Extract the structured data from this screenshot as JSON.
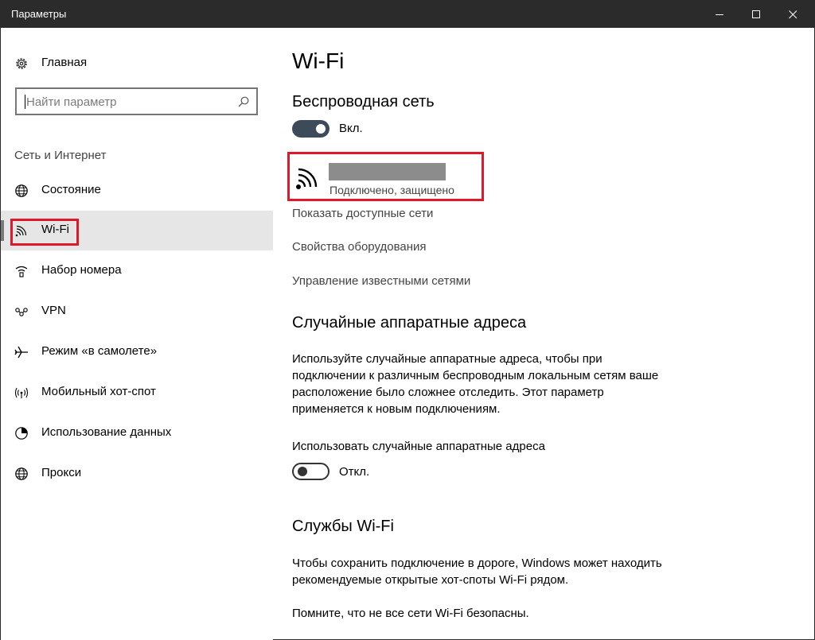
{
  "window": {
    "title": "Параметры"
  },
  "sidebar": {
    "home_label": "Главная",
    "search_placeholder": "Найти параметр",
    "section_label": "Сеть и Интернет",
    "items": [
      {
        "label": "Состояние",
        "icon": "globe-icon"
      },
      {
        "label": "Wi-Fi",
        "icon": "wifi-icon",
        "selected": true
      },
      {
        "label": "Набор номера",
        "icon": "dialup-icon"
      },
      {
        "label": "VPN",
        "icon": "vpn-icon"
      },
      {
        "label": "Режим «в самолете»",
        "icon": "airplane-icon"
      },
      {
        "label": "Мобильный хот-спот",
        "icon": "hotspot-icon"
      },
      {
        "label": "Использование данных",
        "icon": "data-usage-icon"
      },
      {
        "label": "Прокси",
        "icon": "globe-icon"
      }
    ]
  },
  "main": {
    "title": "Wi-Fi",
    "wireless": {
      "heading": "Беспроводная сеть",
      "toggle_state": "Вкл.",
      "network_status": "Подключено, защищено"
    },
    "links": {
      "show_networks": "Показать доступные сети",
      "hardware_props": "Свойства оборудования",
      "manage_known": "Управление известными сетями"
    },
    "random_hw": {
      "heading": "Случайные аппаратные адреса",
      "description": "Используйте случайные аппаратные адреса, чтобы при подключении к различным беспроводным локальным сетям ваше расположение было сложнее отследить. Этот параметр применяется к новым подключениям.",
      "toggle_label": "Использовать случайные аппаратные адреса",
      "toggle_state": "Откл."
    },
    "wifi_services": {
      "heading": "Службы Wi-Fi",
      "description": "Чтобы сохранить подключение в дороге, Windows может находить рекомендуемые открытые хот-споты Wi-Fi рядом.",
      "note": "Помните, что не все сети Wi-Fi безопасны."
    }
  },
  "colors": {
    "highlight_box": "#e0192a",
    "titlebar": "#2b2b2b",
    "toggle_on": "#3c4a5a",
    "selected_bg": "#e6e6e6"
  }
}
